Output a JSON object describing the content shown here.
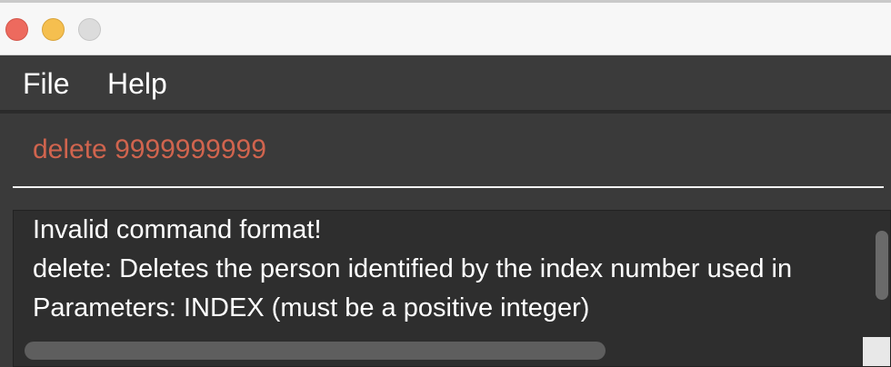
{
  "window": {
    "controls": {
      "close": "close-icon",
      "minimize": "minimize-icon",
      "zoom": "zoom-icon"
    }
  },
  "menu": {
    "file_label": "File",
    "help_label": "Help"
  },
  "command": {
    "value": "delete 9999999999",
    "error_color": "#d0644e"
  },
  "result": {
    "lines": [
      "Invalid command format!",
      "delete: Deletes the person identified by the index number used in",
      "Parameters: INDEX (must be a positive integer)"
    ]
  },
  "colors": {
    "menubar": "#3b3b3b",
    "background": "#2e2e2e",
    "text": "#ffffff"
  }
}
